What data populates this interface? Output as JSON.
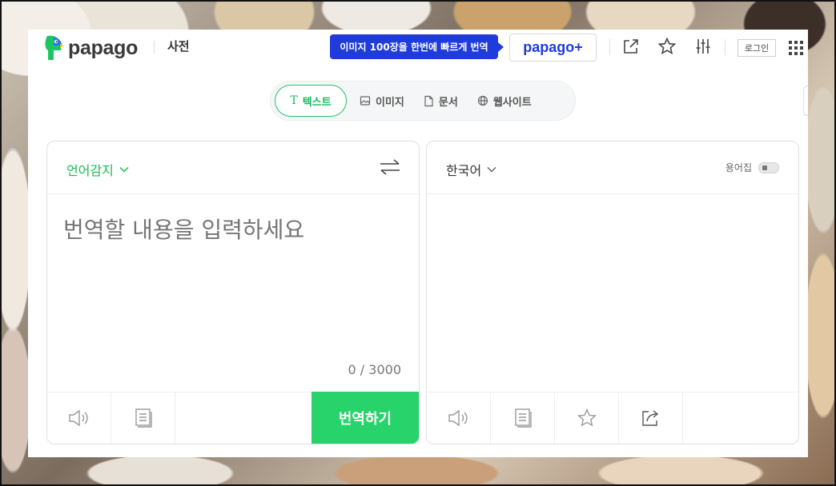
{
  "header": {
    "brand": "papago",
    "dict_label": "사전",
    "promo_text": "이미지 100장을 한번에 빠르게 번역",
    "plus_label": "papago+",
    "login_label": "로그인",
    "icons": [
      "share-window-icon",
      "star-icon",
      "settings-sliders-icon",
      "apps-grid-icon"
    ]
  },
  "tabs": [
    {
      "label": "텍스트",
      "icon": "text-icon",
      "active": true
    },
    {
      "label": "이미지",
      "icon": "image-icon",
      "active": false
    },
    {
      "label": "문서",
      "icon": "document-icon",
      "active": false
    },
    {
      "label": "웹사이트",
      "icon": "globe-icon",
      "active": false
    }
  ],
  "source": {
    "language": "언어감지",
    "placeholder": "번역할 내용을 입력하세요",
    "counter": "0 / 3000",
    "translate_label": "번역하기"
  },
  "target": {
    "language": "한국어",
    "glossary_label": "용어집"
  },
  "colors": {
    "accent_green": "#27d36a",
    "promo_blue": "#1f3cdb"
  }
}
